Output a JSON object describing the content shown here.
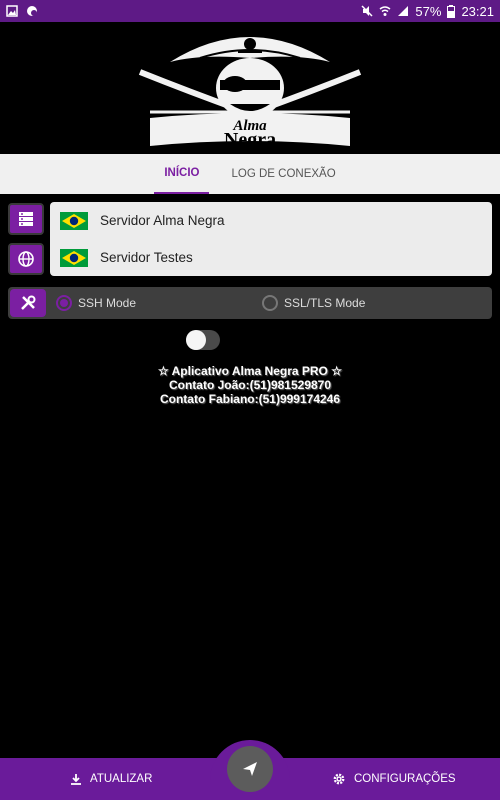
{
  "status_bar": {
    "battery": "57%",
    "time": "23:21"
  },
  "logo": {
    "line1": "Alma",
    "line2": "Negra"
  },
  "tabs": [
    {
      "label": "INÍCIO",
      "active": true
    },
    {
      "label": "LOG DE CONEXÃO",
      "active": false
    }
  ],
  "servers": [
    {
      "name": "Servidor Alma Negra",
      "flag": "brazil-flag"
    },
    {
      "name": "Servidor Testes",
      "flag": "brazil-flag"
    }
  ],
  "modes": [
    {
      "label": "SSH Mode",
      "selected": true
    },
    {
      "label": "SSL/TLS Mode",
      "selected": false
    }
  ],
  "toggle": {
    "on": false
  },
  "info": {
    "line1": "☆ Aplicativo Alma Negra PRO ☆",
    "line2": "Contato João:(51)981529870",
    "line3": "Contato Fabiano:(51)999174246"
  },
  "bottom_nav": {
    "update_label": "ATUALIZAR",
    "settings_label": "CONFIGURAÇÕES"
  },
  "colors": {
    "accent": "#7b1fa2",
    "status_bar": "#5e1a86",
    "nav": "#6a1b9a"
  }
}
